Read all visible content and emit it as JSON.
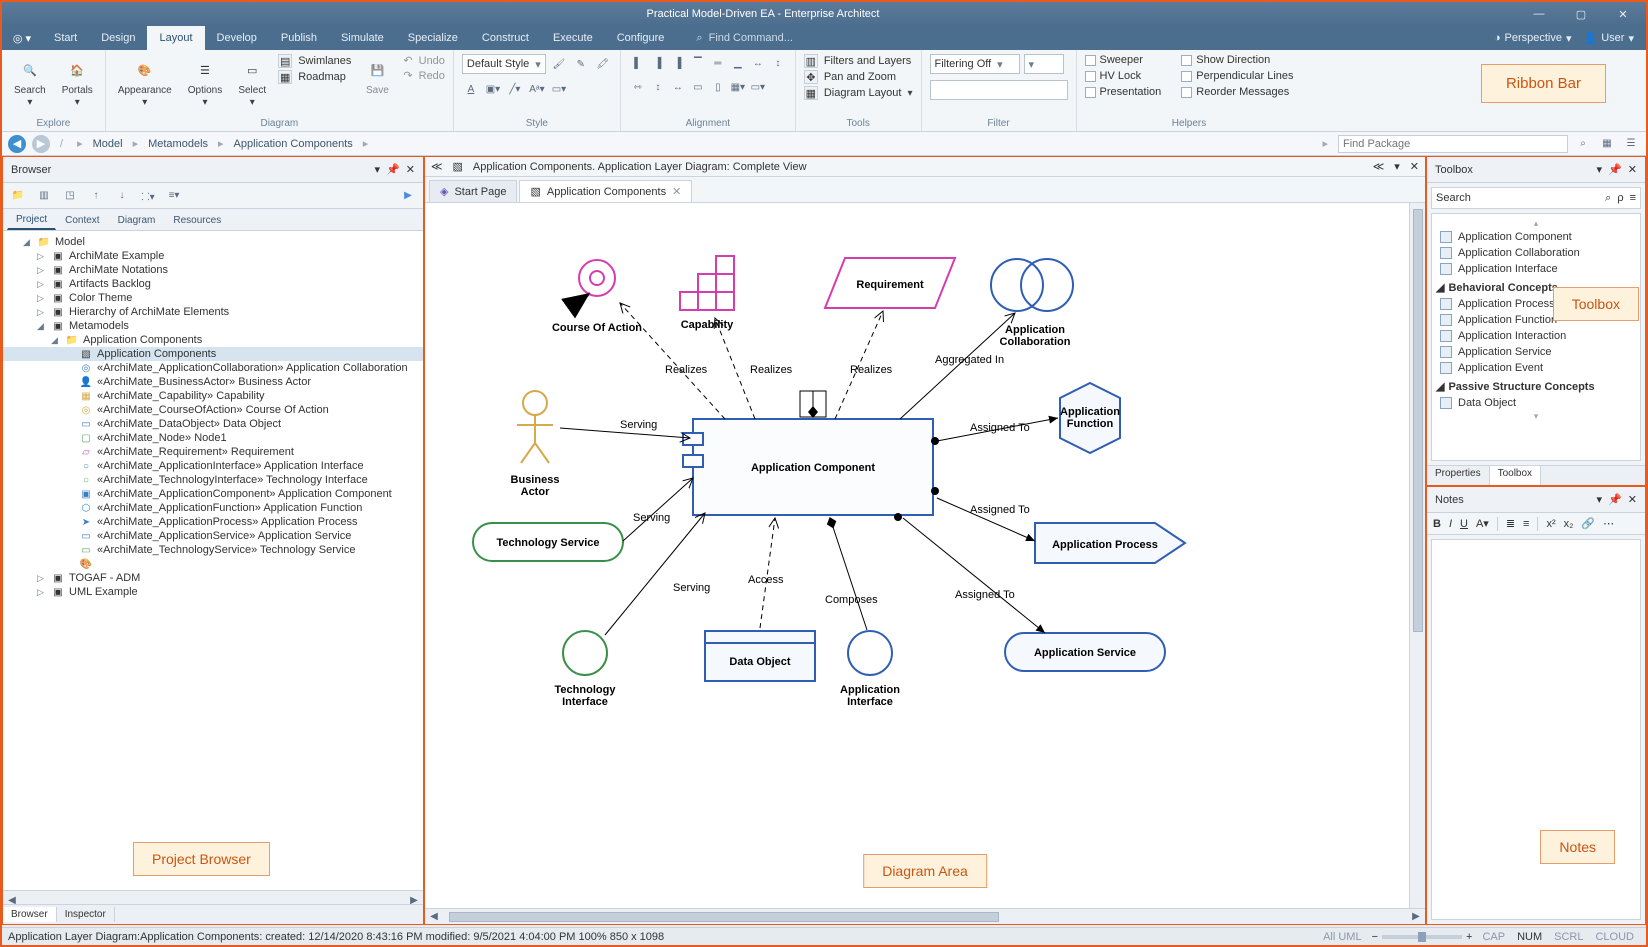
{
  "window": {
    "title": "Practical Model-Driven EA - Enterprise Architect",
    "perspective": "Perspective",
    "user": "User"
  },
  "menu_tabs": {
    "items": [
      "Start",
      "Design",
      "Layout",
      "Develop",
      "Publish",
      "Simulate",
      "Specialize",
      "Construct",
      "Execute",
      "Configure"
    ],
    "active": "Layout",
    "find_cmd": "Find Command..."
  },
  "ribbon": {
    "groups": {
      "explore": {
        "label": "Explore",
        "search": "Search",
        "portals": "Portals"
      },
      "diagram": {
        "label": "Diagram",
        "appearance": "Appearance",
        "options": "Options",
        "select": "Select",
        "swimlanes": "Swimlanes",
        "roadmap": "Roadmap",
        "save": "Save",
        "undo": "Undo",
        "redo": "Redo"
      },
      "style": {
        "label": "Style",
        "default_style": "Default Style"
      },
      "alignment": {
        "label": "Alignment"
      },
      "tools": {
        "label": "Tools",
        "filters": "Filters and Layers",
        "panzoom": "Pan and Zoom",
        "dlayout": "Diagram Layout"
      },
      "filter": {
        "label": "Filter",
        "filtering_off": "Filtering Off"
      },
      "helpers": {
        "label": "Helpers",
        "sweeper": "Sweeper",
        "hvlock": "HV Lock",
        "presentation": "Presentation",
        "showdir": "Show Direction",
        "perp": "Perpendicular Lines",
        "reorder": "Reorder Messages"
      }
    },
    "annotation": "Ribbon Bar"
  },
  "breadcrumb": {
    "items": [
      "Model",
      "Metamodels",
      "Application Components"
    ],
    "find_pkg": "Find Package"
  },
  "browser": {
    "title": "Browser",
    "tabs": [
      "Project",
      "Context",
      "Diagram",
      "Resources"
    ],
    "active_tab": "Project",
    "bottom_tabs": [
      "Browser",
      "Inspector"
    ],
    "active_bottom": "Browser",
    "annotation": "Project Browser",
    "tree": {
      "model": "Model",
      "c1": "ArchiMate Example",
      "c2": "ArchiMate Notations",
      "c3": "Artifacts Backlog",
      "c4": "Color Theme",
      "c5": "Hierarchy of ArchiMate Elements",
      "c6": "Metamodels",
      "c7": "Application Components",
      "c7d": "Application Components",
      "c7a": "«ArchiMate_ApplicationCollaboration» Application Collaboration",
      "c7b": "«ArchiMate_BusinessActor» Business Actor",
      "c7c": "«ArchiMate_Capability» Capability",
      "c7cd": "«ArchiMate_CourseOfAction» Course Of Action",
      "c7e": "«ArchiMate_DataObject» Data Object",
      "c7f": "«ArchiMate_Node» Node1",
      "c7g": "«ArchiMate_Requirement» Requirement",
      "c7h": "«ArchiMate_ApplicationInterface» Application Interface",
      "c7i": "«ArchiMate_TechnologyInterface» Technology Interface",
      "c7j": "«ArchiMate_ApplicationComponent» Application Component",
      "c7k": "«ArchiMate_ApplicationFunction» Application Function",
      "c7l": "«ArchiMate_ApplicationProcess» Application Process",
      "c7m": "«ArchiMate_ApplicationService» Application Service",
      "c7n": "«ArchiMate_TechnologyService» Technology Service",
      "c8": "TOGAF - ADM",
      "c9": "UML Example"
    }
  },
  "canvas": {
    "path": "Application Components.  Application Layer Diagram: Complete View",
    "tab_start": "Start Page",
    "tab_active": "Application Components",
    "annotation": "Diagram Area",
    "elements": {
      "course": "Course Of Action",
      "capability": "Capability",
      "requirement": "Requirement",
      "appcollab": "Application Collaboration",
      "bizactor": "Business Actor",
      "appcomp": "Application Component",
      "appfunc": "Application Function",
      "techservice": "Technology Service",
      "appprocess": "Application Process",
      "techif": "Technology Interface",
      "dataobj": "Data Object",
      "appif": "Application Interface",
      "appservice": "Application Service"
    },
    "labels": {
      "realizes": "Realizes",
      "aggregated": "Aggregated In",
      "serving": "Serving",
      "assigned": "Assigned To",
      "access": "Access",
      "composes": "Composes"
    }
  },
  "toolbox": {
    "title": "Toolbox",
    "search_ph": "Search",
    "annotation": "Toolbox",
    "items_top": [
      "Application Component",
      "Application Collaboration",
      "Application Interface"
    ],
    "group_b": "Behavioral Concepts",
    "items_b": [
      "Application Process",
      "Application Function",
      "Application Interaction",
      "Application Service",
      "Application Event"
    ],
    "group_p": "Passive Structure Concepts",
    "items_p": [
      "Data Object"
    ],
    "tabs": [
      "Properties",
      "Toolbox"
    ],
    "active_tab": "Toolbox"
  },
  "notes": {
    "title": "Notes",
    "annotation": "Notes"
  },
  "status": {
    "left": "Application Layer Diagram:Application Components:   created: 12/14/2020 8:43:16 PM  modified: 9/5/2021 4:04:00 PM   100%   850 x 1098",
    "all_uml": "All UML",
    "cap": "CAP",
    "num": "NUM",
    "scrl": "SCRL",
    "cloud": "CLOUD"
  }
}
